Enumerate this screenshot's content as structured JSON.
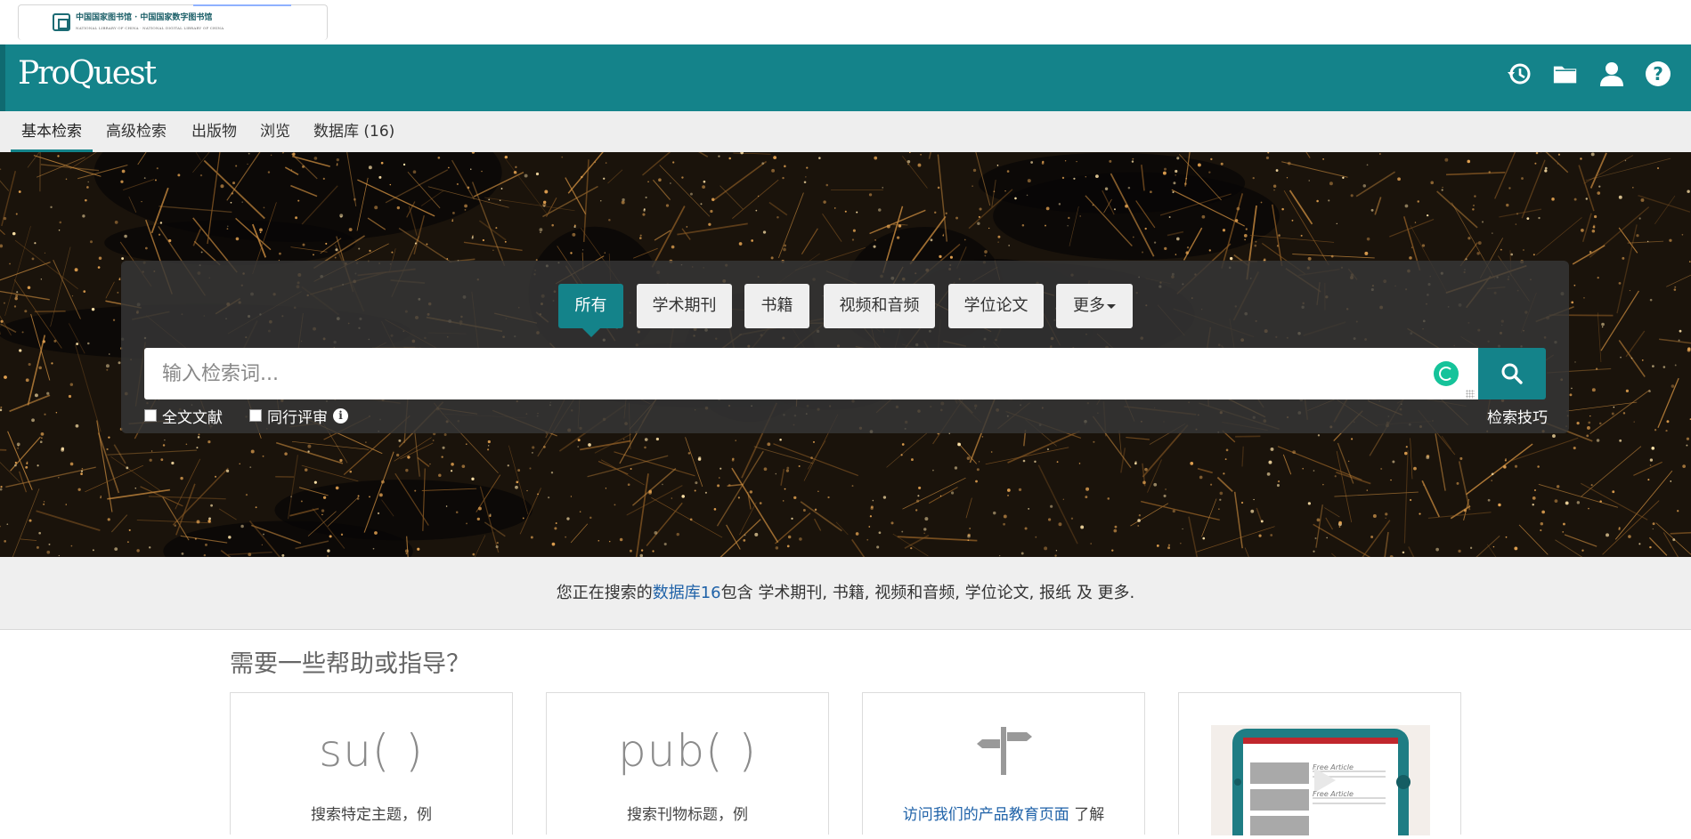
{
  "institution": {
    "name_cn": "中国国家图书馆 · 中国国家数字图书馆",
    "name_en": "NATIONAL LIBRARY OF CHINA · NATIONAL DIGITAL LIBRARY OF CHINA"
  },
  "header": {
    "brand": "ProQuest",
    "icons": [
      "history-icon",
      "folder-icon",
      "user-icon",
      "help-icon"
    ]
  },
  "nav": {
    "items": [
      {
        "label": "基本检索",
        "active": true
      },
      {
        "label": "高级检索",
        "active": false
      },
      {
        "label": "出版物",
        "active": false
      },
      {
        "label": "浏览",
        "active": false
      },
      {
        "label": "数据库 (16)",
        "active": false
      }
    ]
  },
  "search": {
    "tabs": [
      "所有",
      "学术期刊",
      "书籍",
      "视频和音频",
      "学位论文",
      "更多"
    ],
    "active_tab": "所有",
    "placeholder": "输入检索词...",
    "value": "",
    "fulltext_label": "全文文献",
    "fulltext_checked": false,
    "peer_label": "同行评审",
    "peer_checked": false,
    "tips_label": "检索技巧"
  },
  "info": {
    "prefix": "您正在搜索的",
    "db_link": "数据库16",
    "suffix": "包含 学术期刊, 书籍, 视频和音频, 学位论文, 报纸 及 更多."
  },
  "help": {
    "title": "需要一些帮助或指导？",
    "cards": [
      {
        "big": "su( )",
        "desc": "搜索特定主题，例"
      },
      {
        "big": "pub( )",
        "desc": "搜索刊物标题，例"
      },
      {
        "link": "访问我们的产品教育页面",
        "desc_suffix": " 了解"
      },
      {
        "thumb_labels": [
          "Free Article",
          "Free Article"
        ]
      }
    ]
  },
  "colors": {
    "brand": "#14838a",
    "link": "#1f62a8",
    "grammarly": "#15c39a"
  }
}
